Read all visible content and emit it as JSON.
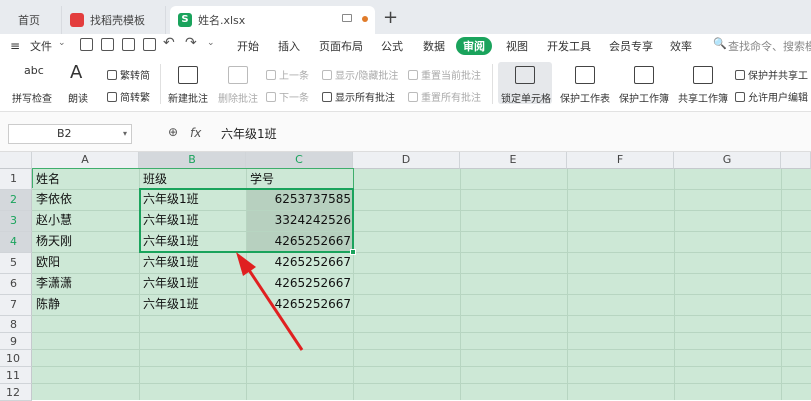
{
  "tabs": [
    {
      "label": "首页"
    },
    {
      "label": "找稻壳模板"
    },
    {
      "label": "姓名.xlsx"
    }
  ],
  "menu": {
    "file": "文件",
    "items": [
      "开始",
      "插入",
      "页面布局",
      "公式",
      "数据",
      "审阅",
      "视图",
      "开发工具",
      "会员专享",
      "效率"
    ],
    "active": "审阅",
    "search_placeholder": "查找命令、搜索模板"
  },
  "ribbon": {
    "spellcheck": "拼写检查",
    "spellcheck_icon": "abc",
    "read": "朗读",
    "read_icon": "A",
    "to_traditional": "繁转简",
    "to_simplified": "简转繁",
    "new_comment": "新建批注",
    "delete_comment": "删除批注",
    "prev": "上一条",
    "next": "下一条",
    "show_hide_comment": "显示/隐藏批注",
    "show_all_comments": "显示所有批注",
    "reset_current": "重置当前批注",
    "reset_all": "重置所有批注",
    "lock_cell": "锁定单元格",
    "protect_sheet": "保护工作表",
    "protect_workbook": "保护工作簿",
    "share_workbook": "共享工作簿",
    "protect_share": "保护并共享工",
    "allow_edit": "允许用户编辑"
  },
  "formula_bar": {
    "name_box": "B2",
    "fx": "fx",
    "content": "六年级1班"
  },
  "columns": [
    "A",
    "B",
    "C",
    "D",
    "E",
    "F",
    "G"
  ],
  "rows": [
    "1",
    "2",
    "3",
    "4",
    "5",
    "6",
    "7",
    "8",
    "9",
    "10",
    "11",
    "12"
  ],
  "table": {
    "headers": [
      "姓名",
      "班级",
      "学号"
    ],
    "data": [
      [
        "李依依",
        "六年级1班",
        "6253737585"
      ],
      [
        "赵小慧",
        "六年级1班",
        "3324242526"
      ],
      [
        "杨天刚",
        "六年级1班",
        "4265252667"
      ],
      [
        "欧阳",
        "六年级1班",
        "4265252667"
      ],
      [
        "李潇潇",
        "六年级1班",
        "4265252667"
      ],
      [
        "陈静",
        "六年级1班",
        "4265252667"
      ]
    ]
  },
  "colors": {
    "accent": "#1aa35c",
    "grid_bg": "#cde8d6",
    "arrow": "#e02020"
  }
}
